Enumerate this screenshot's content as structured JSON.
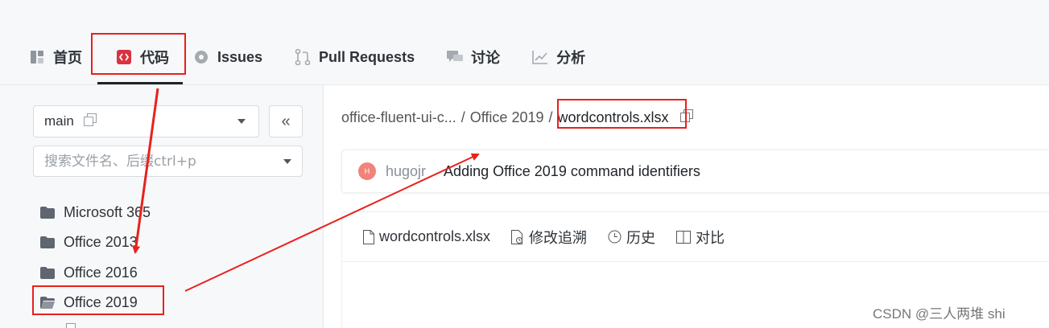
{
  "tabs": [
    {
      "label": "首页",
      "icon": "home-icon"
    },
    {
      "label": "代码",
      "icon": "code-icon"
    },
    {
      "label": "Issues",
      "icon": "issues-icon"
    },
    {
      "label": "Pull Requests",
      "icon": "pull-request-icon"
    },
    {
      "label": "讨论",
      "icon": "discussion-icon"
    },
    {
      "label": "分析",
      "icon": "analytics-icon"
    }
  ],
  "active_tab": "代码",
  "sidebar": {
    "branch": "main",
    "search_placeholder": "搜索文件名、后缀ctrl+p",
    "tree": [
      {
        "label": "Microsoft 365",
        "type": "folder"
      },
      {
        "label": "Office 2013",
        "type": "folder"
      },
      {
        "label": "Office 2016",
        "type": "folder"
      },
      {
        "label": "Office 2019",
        "type": "folder"
      }
    ]
  },
  "breadcrumb": {
    "repo": "office-fluent-ui-c...",
    "sep": "/",
    "folder": "Office 2019",
    "file": "wordcontrols.xlsx"
  },
  "commit": {
    "avatar": "H",
    "author": "hugojr",
    "message": "Adding Office 2019 command identifiers"
  },
  "file_toolbar": {
    "filename": "wordcontrols.xlsx",
    "blame": "修改追溯",
    "history": "历史",
    "compare": "对比"
  },
  "watermark": "CSDN @三人两堆 shi",
  "colors": {
    "annotation_red": "#e8211c",
    "code_icon_red": "#d9333f",
    "avatar_bg": "#f0837a"
  }
}
